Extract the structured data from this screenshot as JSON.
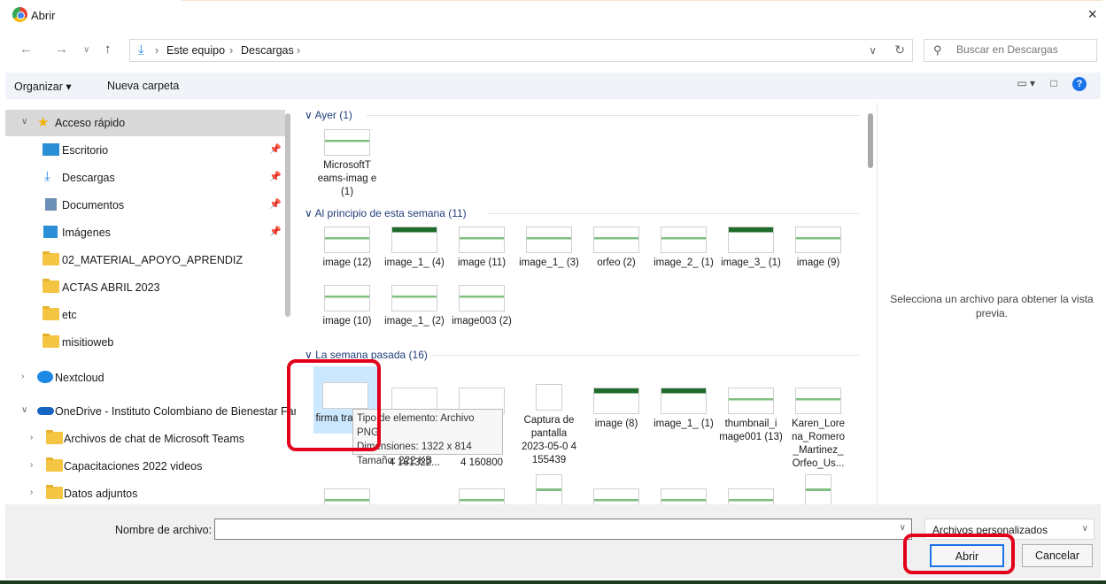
{
  "window": {
    "title": "Abrir",
    "close_icon": "×"
  },
  "address": {
    "crumbs": [
      "Este equipo",
      "Descargas"
    ],
    "search_placeholder": "Buscar en Descargas"
  },
  "toolbar": {
    "organize": "Organizar",
    "new_folder": "Nueva carpeta"
  },
  "sidebar": {
    "quick_access": "Acceso rápido",
    "items": [
      "Escritorio",
      "Descargas",
      "Documentos",
      "Imágenes",
      "02_MATERIAL_APOYO_APRENDIZ",
      "ACTAS ABRIL 2023",
      "etc",
      "misitioweb"
    ],
    "nextcloud": "Nextcloud",
    "onedrive": "OneDrive - Instituto Colombiano de Bienestar Fam",
    "onedrive_items": [
      "Archivos de chat de Microsoft Teams",
      "Capacitaciones 2022 videos",
      "Datos adjuntos"
    ]
  },
  "groups": {
    "yesterday": "Ayer (1)",
    "this_week": "Al principio de esta semana (11)",
    "last_week": "La semana pasada (16)"
  },
  "files": {
    "yesterday": [
      "MicrosoftT eams-imag e (1)"
    ],
    "week_row1": [
      "image (12)",
      "image_1_ (4)",
      "image (11)",
      "image_1_ (3)",
      "orfeo (2)",
      "image_2_ (1)",
      "image_3_ (1)",
      "image (9)"
    ],
    "week_row2": [
      "image (10)",
      "image_1_ (2)",
      "image003 (2)"
    ],
    "last_week_row1": [
      "firma transpa",
      "",
      "",
      "Captura de pantalla 2023-05-0 4 155439",
      "image (8)",
      "image_1_ (1)",
      "thumbnail_i mage001 (13)",
      "Karen_Lore na_Romero _Martinez_ Orfeo_Us..."
    ],
    "partial": [
      "4 161322...",
      "4 160800"
    ]
  },
  "tooltip": {
    "type": "Tipo de elemento: Archivo PNG",
    "dims": "Dimensiones: 1322 x 814",
    "size": "Tamaño: 222 KB"
  },
  "preview_text": "Selecciona un archivo para obtener la vista previa.",
  "bottom": {
    "filename_label": "Nombre de archivo:",
    "filename_value": "",
    "filetype": "Archivos personalizados",
    "open": "Abrir",
    "cancel": "Cancelar"
  }
}
